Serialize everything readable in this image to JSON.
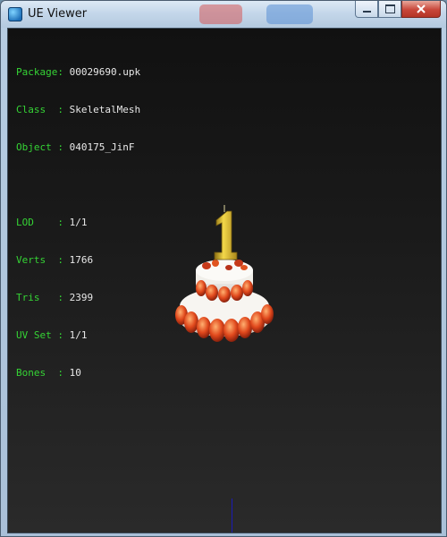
{
  "window": {
    "title": "UE Viewer"
  },
  "info": {
    "package_key": "Package:",
    "package": "00029690.upk",
    "class_key": "Class  :",
    "class": "SkeletalMesh",
    "object_key": "Object :",
    "object": "040175_JinF",
    "lod_key": "LOD    :",
    "lod": "1/1",
    "verts_key": "Verts  :",
    "verts": "1766",
    "tris_key": "Tris   :",
    "tris": "2399",
    "uvset_key": "UV Set :",
    "uvset": "1/1",
    "bones_key": "Bones  :",
    "bones": "10"
  },
  "colors": {
    "label": "#35d435",
    "value": "#e8e8e8",
    "axis": "#1b1bb5",
    "candle": "#e2c02a",
    "strawberry": "#d9431f",
    "cream": "#f4f2ee"
  },
  "model": {
    "candle_number": "1"
  }
}
